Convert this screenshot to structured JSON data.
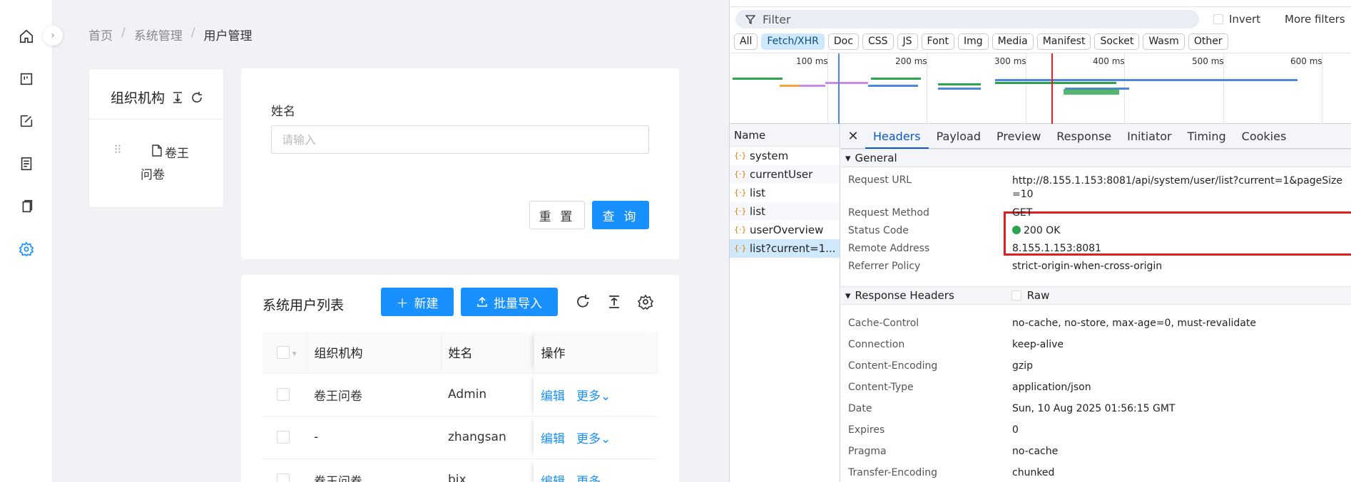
{
  "breadcrumb": {
    "items": [
      "首页",
      "系统管理",
      "用户管理"
    ]
  },
  "org": {
    "title": "组织机构",
    "node": "卷王问卷"
  },
  "search": {
    "name_label": "姓名",
    "placeholder": "请输入",
    "reset_label": "重 置",
    "query_label": "查 询"
  },
  "list": {
    "title": "系统用户列表",
    "new_label": "新建",
    "import_label": "批量导入",
    "columns": [
      "组织机构",
      "姓名",
      "操作"
    ],
    "rows": [
      {
        "org": "卷王问卷",
        "name": "Admin",
        "edit": "编辑",
        "more": "更多"
      },
      {
        "org": "-",
        "name": "zhangsan",
        "edit": "编辑",
        "more": "更多"
      },
      {
        "org": "卷王问卷",
        "name": "bix",
        "edit": "编辑",
        "more": "更多"
      }
    ]
  },
  "devtools": {
    "filter_placeholder": "Filter",
    "invert_label": "Invert",
    "more_filters": "More filters",
    "chips": [
      "All",
      "Fetch/XHR",
      "Doc",
      "CSS",
      "JS",
      "Font",
      "Img",
      "Media",
      "Manifest",
      "Socket",
      "Wasm",
      "Other"
    ],
    "active_chip": "Fetch/XHR",
    "ticks": [
      "100 ms",
      "200 ms",
      "300 ms",
      "400 ms",
      "500 ms",
      "600 ms"
    ],
    "name_header": "Name",
    "requests": [
      "system",
      "currentUser",
      "list",
      "list",
      "userOverview",
      "list?current=1..."
    ],
    "tabs": [
      "Headers",
      "Payload",
      "Preview",
      "Response",
      "Initiator",
      "Timing",
      "Cookies"
    ],
    "general_title": "General",
    "general": [
      {
        "k": "Request URL",
        "v": "http://8.155.1.153:8081/api/system/user/list?current=1&pageSize=10"
      },
      {
        "k": "Request Method",
        "v": "GET"
      },
      {
        "k": "Status Code",
        "v": "200 OK"
      },
      {
        "k": "Remote Address",
        "v": "8.155.1.153:8081"
      },
      {
        "k": "Referrer Policy",
        "v": "strict-origin-when-cross-origin"
      }
    ],
    "response_title": "Response Headers",
    "raw_label": "Raw",
    "response": [
      {
        "k": "Cache-Control",
        "v": "no-cache, no-store, max-age=0, must-revalidate"
      },
      {
        "k": "Connection",
        "v": "keep-alive"
      },
      {
        "k": "Content-Encoding",
        "v": "gzip"
      },
      {
        "k": "Content-Type",
        "v": "application/json"
      },
      {
        "k": "Date",
        "v": "Sun, 10 Aug 2025 01:56:15 GMT"
      },
      {
        "k": "Expires",
        "v": "0"
      },
      {
        "k": "Pragma",
        "v": "no-cache"
      },
      {
        "k": "Transfer-Encoding",
        "v": "chunked"
      }
    ]
  },
  "colors": {
    "primary": "#1890ff",
    "highlight": "#e02020",
    "status_ok": "#2ca44e"
  }
}
